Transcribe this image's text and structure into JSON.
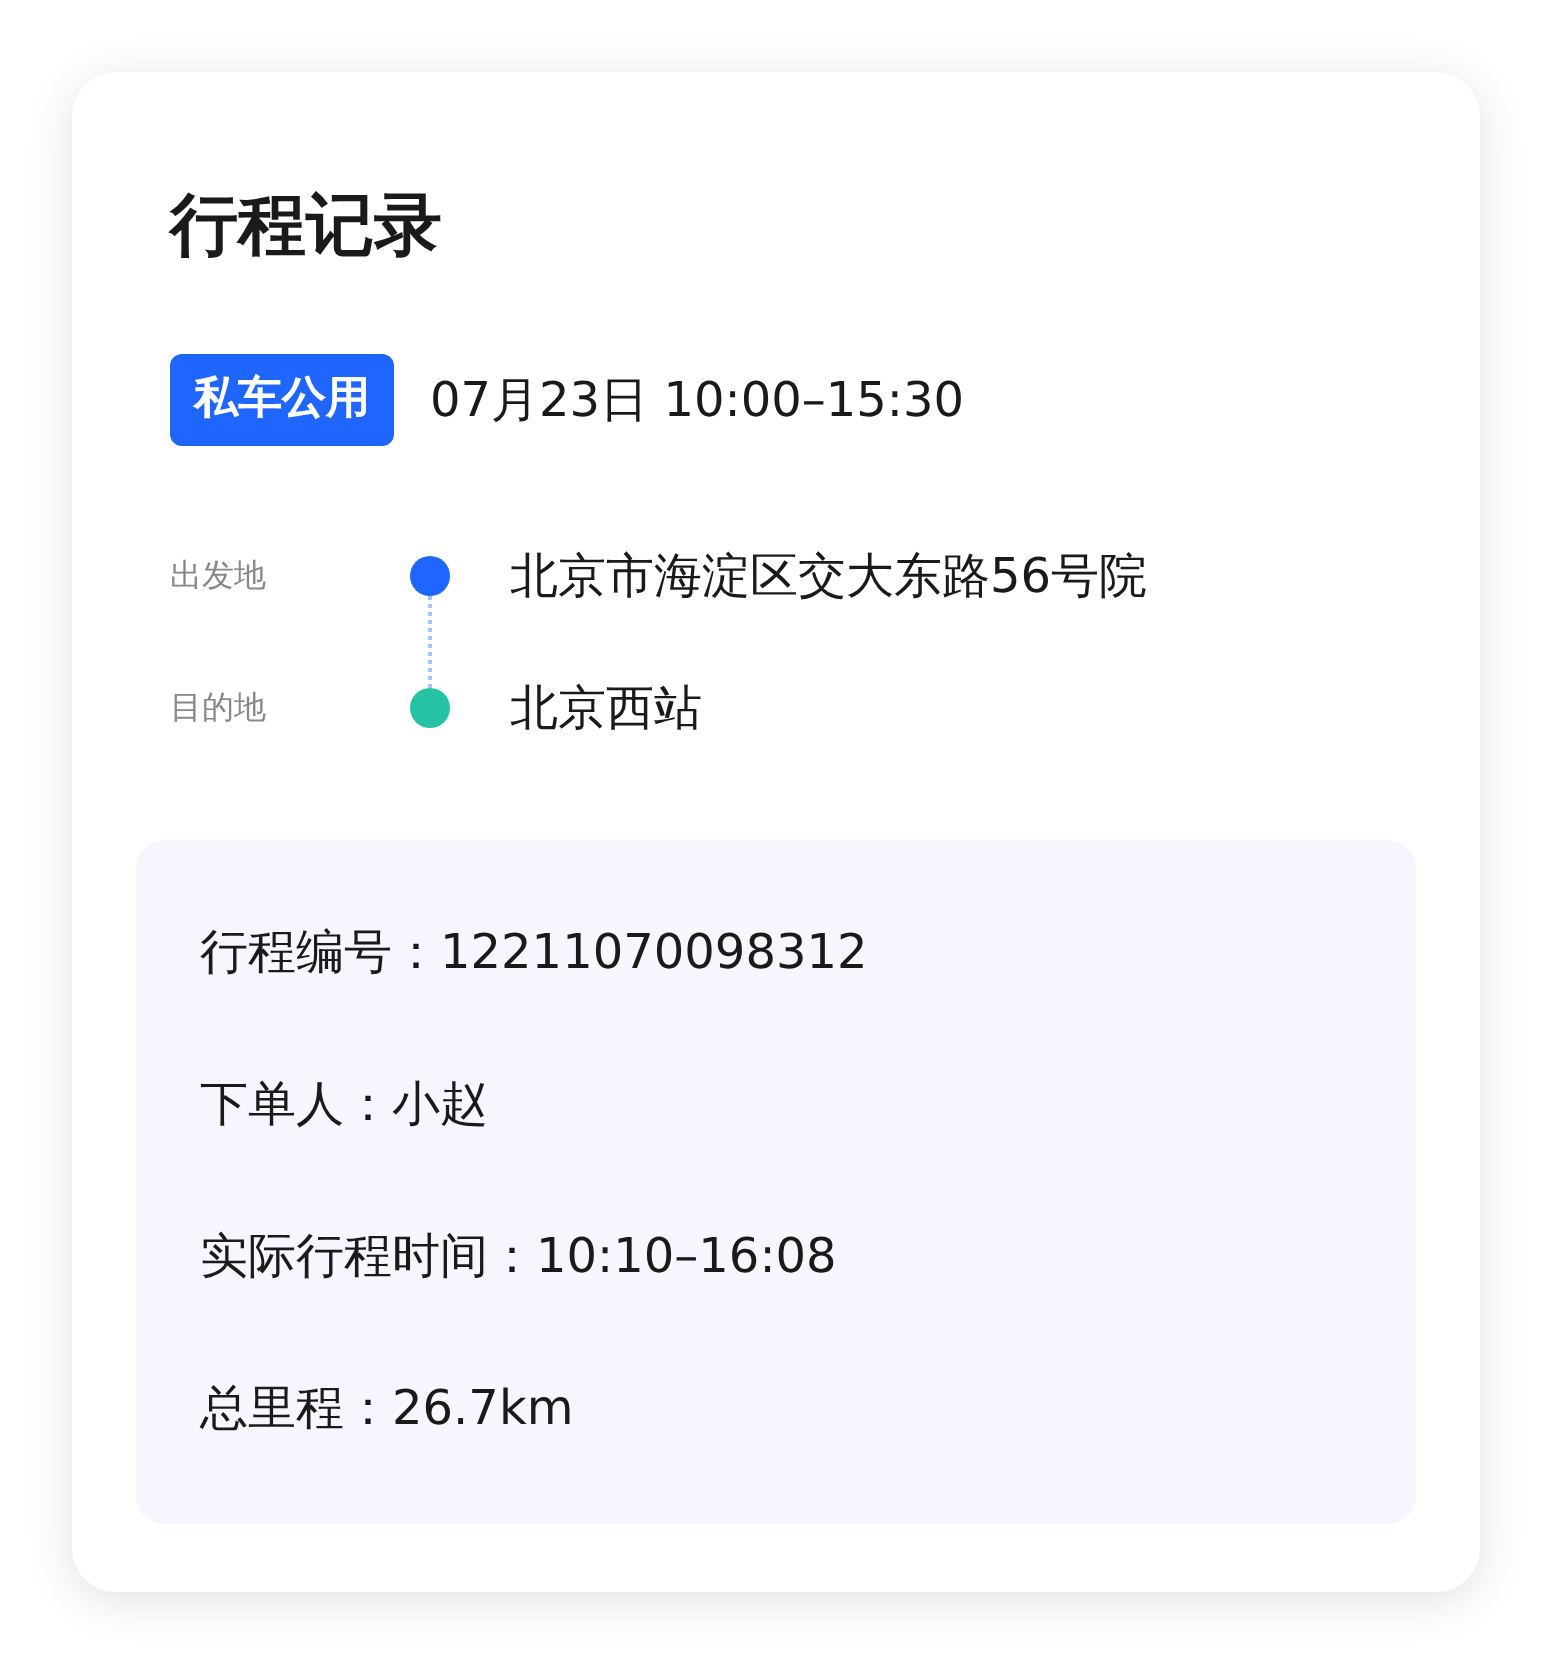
{
  "title": "行程记录",
  "trip": {
    "tag": "私车公用",
    "time": "07月23日 10:00–15:30"
  },
  "route": [
    {
      "label": "出发地",
      "place": "北京市海淀区交大东路56号院",
      "color": "#1f66ff"
    },
    {
      "label": "目的地",
      "place": "北京西站",
      "color": "#26c2a4"
    }
  ],
  "details": [
    {
      "text": "行程编号：12211070098312"
    },
    {
      "text": "下单人：小赵"
    },
    {
      "text": "实际行程时间：10:10–16:08"
    },
    {
      "text": "总里程：26.7km"
    }
  ]
}
